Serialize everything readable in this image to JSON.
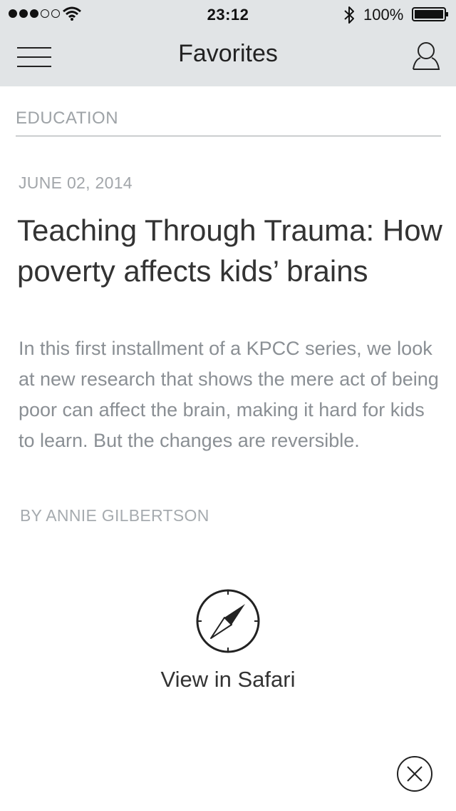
{
  "status_bar": {
    "time": "23:12",
    "battery_percent": "100%",
    "signal_bars_filled": 3,
    "signal_bars_total": 5,
    "icons": [
      "wifi-icon",
      "bluetooth-icon",
      "battery-icon"
    ]
  },
  "nav": {
    "title": "Favorites",
    "icons": [
      "menu-icon",
      "profile-icon"
    ]
  },
  "article": {
    "category": "EDUCATION",
    "date": "JUNE 02, 2014",
    "headline": "Teaching Through Trauma: How poverty affects kids’ brains",
    "summary": "In this first installment of a KPCC series, we look at new research that shows the mere act of being poor can affect the brain, making it hard for kids to learn. But the changes are reversible.",
    "byline": "BY ANNIE GILBERTSON"
  },
  "actions": {
    "view_in_safari_label": "View in Safari",
    "icons": [
      "compass-icon",
      "close-icon"
    ]
  }
}
